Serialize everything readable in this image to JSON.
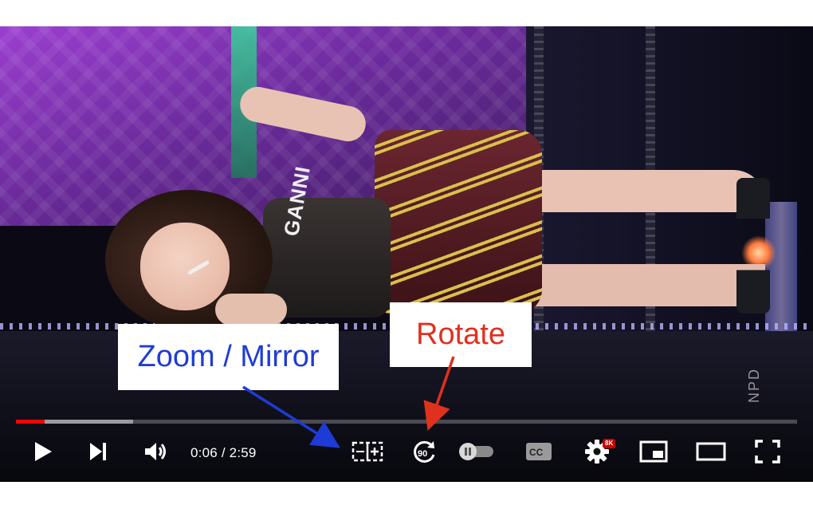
{
  "player": {
    "time": {
      "current": "0:06",
      "separator": " / ",
      "duration": "2:59"
    },
    "progress": {
      "played_fraction": 0.037,
      "loaded_fraction": 0.15
    },
    "shirt_text": "GANNI",
    "watermark": "NPD",
    "settings_badge": "8K",
    "icons": {
      "play": "play-icon",
      "next": "next-icon",
      "volume": "volume-icon",
      "zoom_mirror": "zoom-mirror-icon",
      "rotate": "rotate-icon",
      "autoplay": "autoplay-toggle-icon",
      "captions": "captions-icon",
      "settings": "gear-icon",
      "miniplayer": "miniplayer-icon",
      "theater": "theater-icon",
      "fullscreen": "fullscreen-icon"
    }
  },
  "annotations": {
    "zoom_mirror": {
      "label": "Zoom / Mirror",
      "color": "#1f3bd6"
    },
    "rotate": {
      "label": "Rotate",
      "color": "#e0301e"
    }
  },
  "colors": {
    "progress_played": "#ff0000",
    "controls_fg": "#ffffff"
  }
}
